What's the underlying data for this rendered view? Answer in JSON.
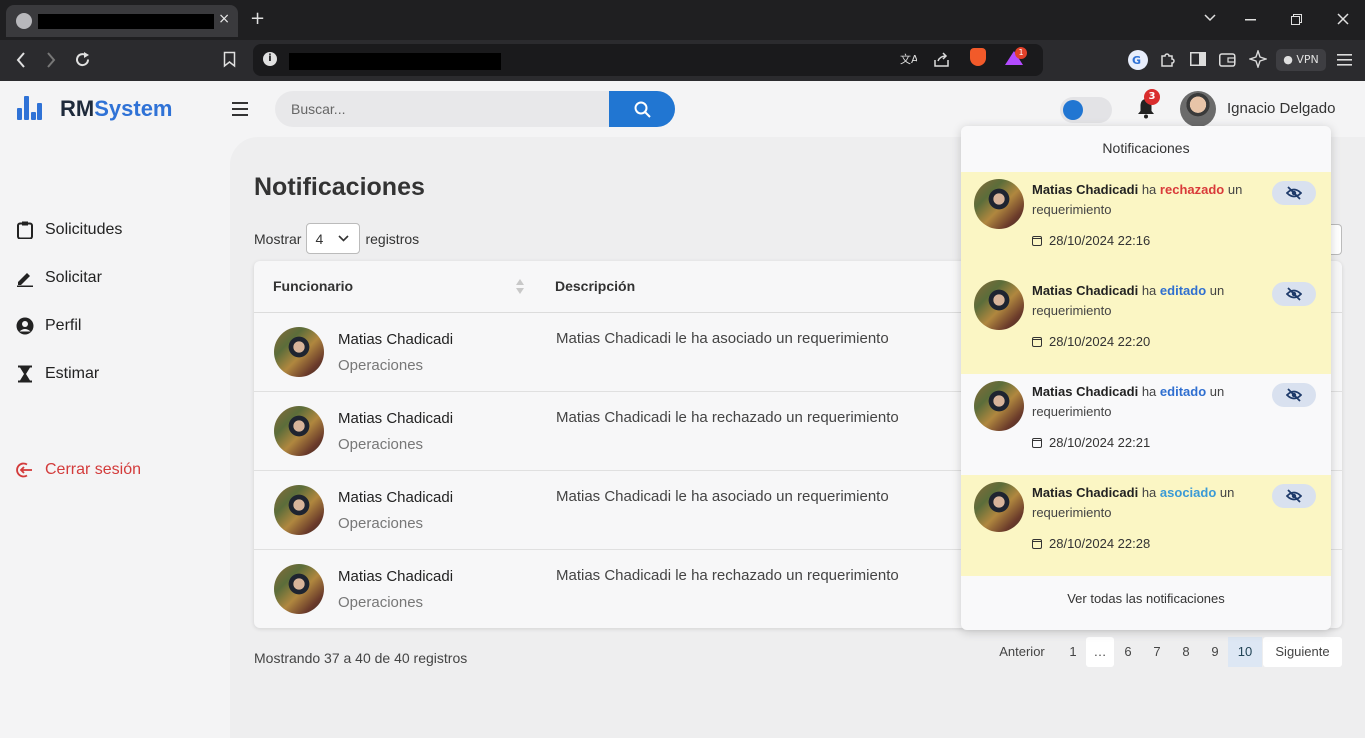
{
  "browser": {
    "vpn_label": "VPN",
    "reward_badge": "1",
    "new_tab": "+",
    "tab_close": "×"
  },
  "app": {
    "brand_prefix": "RM",
    "brand_suffix": "System",
    "search_placeholder": "Buscar...",
    "notifications_count": "3",
    "user_name": "Ignacio Delgado",
    "colors": {
      "accent": "#2176d2",
      "danger": "#d33b3b",
      "unread_bg": "#fbf6c4"
    }
  },
  "sidebar": {
    "items": [
      {
        "label": "Solicitudes",
        "icon": "clipboard-icon"
      },
      {
        "label": "Solicitar",
        "icon": "pencil-icon"
      },
      {
        "label": "Perfil",
        "icon": "user-circle-icon"
      },
      {
        "label": "Estimar",
        "icon": "hourglass-icon"
      }
    ],
    "logout": {
      "label": "Cerrar sesión",
      "icon": "logout-icon"
    }
  },
  "main": {
    "title": "Notificaciones",
    "show_prefix": "Mostrar",
    "show_value": "4",
    "show_suffix": "registros",
    "columns": [
      "Funcionario",
      "Descripción"
    ],
    "rows": [
      {
        "name": "Matias Chadicadi",
        "dept": "Operaciones",
        "desc": "Matias Chadicadi le ha asociado un requerimiento"
      },
      {
        "name": "Matias Chadicadi",
        "dept": "Operaciones",
        "desc": "Matias Chadicadi le ha rechazado un requerimiento"
      },
      {
        "name": "Matias Chadicadi",
        "dept": "Operaciones",
        "desc": "Matias Chadicadi le ha asociado un requerimiento"
      },
      {
        "name": "Matias Chadicadi",
        "dept": "Operaciones",
        "desc": "Matias Chadicadi le ha rechazado un requerimiento"
      }
    ],
    "info": "Mostrando 37 a 40 de 40 registros",
    "pagination": {
      "prev": "Anterior",
      "pages": [
        "1",
        "…",
        "6",
        "7",
        "8",
        "9",
        "10"
      ],
      "current": "10",
      "next": "Siguiente"
    }
  },
  "notifications": {
    "header": "Notificaciones",
    "footer": "Ver todas las notificaciones",
    "items": [
      {
        "who": "Matias Chadicadi",
        "pre": "ha",
        "action": "rechazado",
        "action_color": "#d93a3a",
        "post": "un requerimiento",
        "date": "28/10/2024 22:16",
        "unread": true
      },
      {
        "who": "Matias Chadicadi",
        "pre": "ha",
        "action": "editado",
        "action_color": "#2f6fd0",
        "post": "un requerimiento",
        "date": "28/10/2024 22:20",
        "unread": true
      },
      {
        "who": "Matias Chadicadi",
        "pre": "ha",
        "action": "editado",
        "action_color": "#2f6fd0",
        "post": "un requerimiento",
        "date": "28/10/2024 22:21",
        "unread": false
      },
      {
        "who": "Matias Chadicadi",
        "pre": "ha",
        "action": "asociado",
        "action_color": "#3a9ad6",
        "post": "un requerimiento",
        "date": "28/10/2024 22:28",
        "unread": true
      }
    ]
  }
}
